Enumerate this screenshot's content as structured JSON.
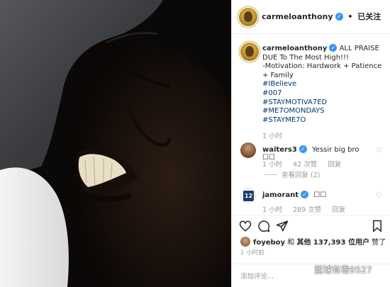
{
  "post": {
    "username": "carmeloanthony",
    "verified_icon": "verified-check-icon",
    "dot": "•",
    "follow_status": "已关注"
  },
  "caption": {
    "username": "carmeloanthony",
    "first_line": "ALL PRAISE DUE To The Most High!!!",
    "motivation_line": "-Motivation: Hardwork + Patience + Family",
    "hashtags": [
      "#IBelieve",
      "#007",
      "#STAYMOTIVA7ED",
      "#ME7OMONDAYS",
      "#STAYME7O"
    ],
    "time": "1 小时"
  },
  "comments": [
    {
      "username": "waiters3",
      "text": "Yessir big bro ☐☐",
      "time": "1 小时",
      "likes": "42 次赞",
      "reply": "回复",
      "view_replies": "查看回复 (2)"
    },
    {
      "username": "jamorant",
      "text": "☐☐",
      "time": "1 小时",
      "likes": "289 次赞",
      "reply": "回复",
      "avatar_jersey": "12"
    }
  ],
  "actions": {
    "icons": [
      "heart-icon",
      "comment-icon",
      "share-icon",
      "bookmark-icon"
    ]
  },
  "likes": {
    "liker": "foyeboy",
    "connector": " 和 ",
    "others": "其他 137,393 位用户",
    "suffix": " 赞了"
  },
  "post_time": "1 小时前",
  "add_comment_placeholder": "添加评论...",
  "watermark": "篮球有毒9527",
  "colors": {
    "verified": "#3897f0",
    "hashtag": "#003569",
    "meta": "#999999"
  }
}
